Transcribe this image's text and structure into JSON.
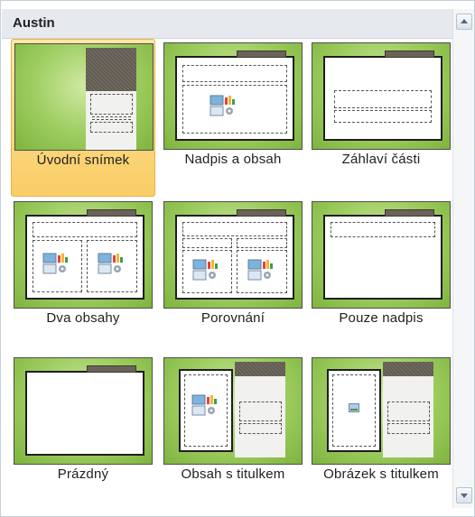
{
  "gallery": {
    "section_title": "Austin",
    "layouts": [
      {
        "label": "Úvodní snímek",
        "selected": true
      },
      {
        "label": "Nadpis a obsah",
        "selected": false
      },
      {
        "label": "Záhlaví části",
        "selected": false
      },
      {
        "label": "Dva obsahy",
        "selected": false
      },
      {
        "label": "Porovnání",
        "selected": false
      },
      {
        "label": "Pouze nadpis",
        "selected": false
      },
      {
        "label": "Prázdný",
        "selected": false
      },
      {
        "label": "Obsah s titulkem",
        "selected": false
      },
      {
        "label": "Obrázek s titulkem",
        "selected": false
      }
    ]
  },
  "colors": {
    "theme_green": "#9ccc5e",
    "selection": "#f9cd65",
    "tab_brown": "#6b635a"
  },
  "icons": [
    "content-placeholder-icon",
    "picture-placeholder-icon",
    "scroll-up-icon",
    "scroll-down-icon"
  ]
}
